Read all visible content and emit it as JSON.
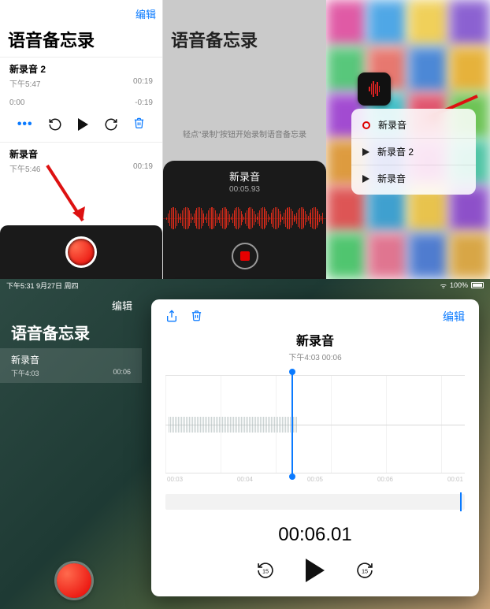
{
  "panel1": {
    "edit": "编辑",
    "title": "语音备忘录",
    "item1": {
      "name": "新录音 2",
      "time": "下午5:47",
      "dur": "00:19",
      "start": "0:00",
      "end": "-0:19"
    },
    "item2": {
      "name": "新录音",
      "time": "下午5:46",
      "dur": "00:19"
    },
    "dots": "•••"
  },
  "panel2": {
    "title": "语音备忘录",
    "hint": "轻点\"录制\"按钮开始录制语音备忘录",
    "rec_name": "新录音",
    "rec_time": "00:05.93"
  },
  "panel3": {
    "items": [
      {
        "label": "新录音"
      },
      {
        "label": "新录音 2"
      },
      {
        "label": "新录音"
      }
    ]
  },
  "ipad": {
    "status_time": "下午5:31  9月27日 周四",
    "battery": "100%",
    "sidebar_edit": "编辑",
    "sidebar_title": "语音备忘录",
    "item": {
      "name": "新录音",
      "time": "下午4:03",
      "dur": "00:06"
    },
    "card_edit": "编辑",
    "card_title": "新录音",
    "card_sub": "下午4:03  00:06",
    "ticks": [
      "00:03",
      "00:04",
      "00:05",
      "00:06",
      "00:01"
    ],
    "timer": "00:06.01",
    "skip": "15"
  }
}
